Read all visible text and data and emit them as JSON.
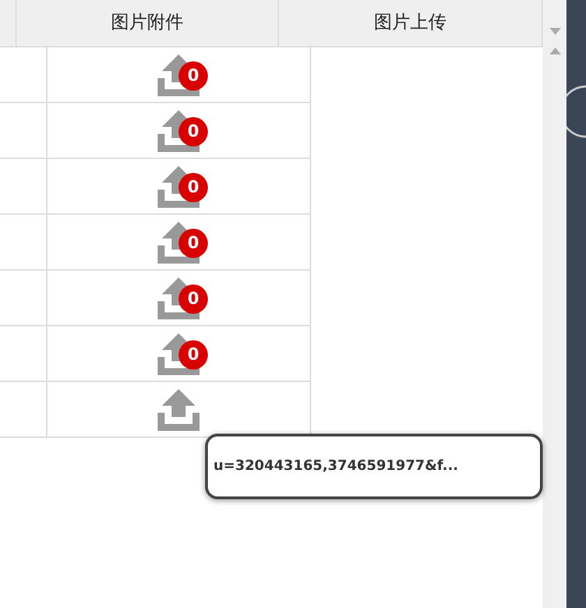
{
  "table": {
    "columns": [
      {
        "label": "图片附件"
      },
      {
        "label": "图片上传"
      }
    ],
    "rows": [
      {
        "count": "0"
      },
      {
        "count": "0"
      },
      {
        "count": "0"
      },
      {
        "count": "0"
      },
      {
        "count": "0"
      },
      {
        "count": "0"
      },
      {}
    ]
  },
  "tooltip": {
    "text": "u=320443165,3746591977&f..."
  }
}
